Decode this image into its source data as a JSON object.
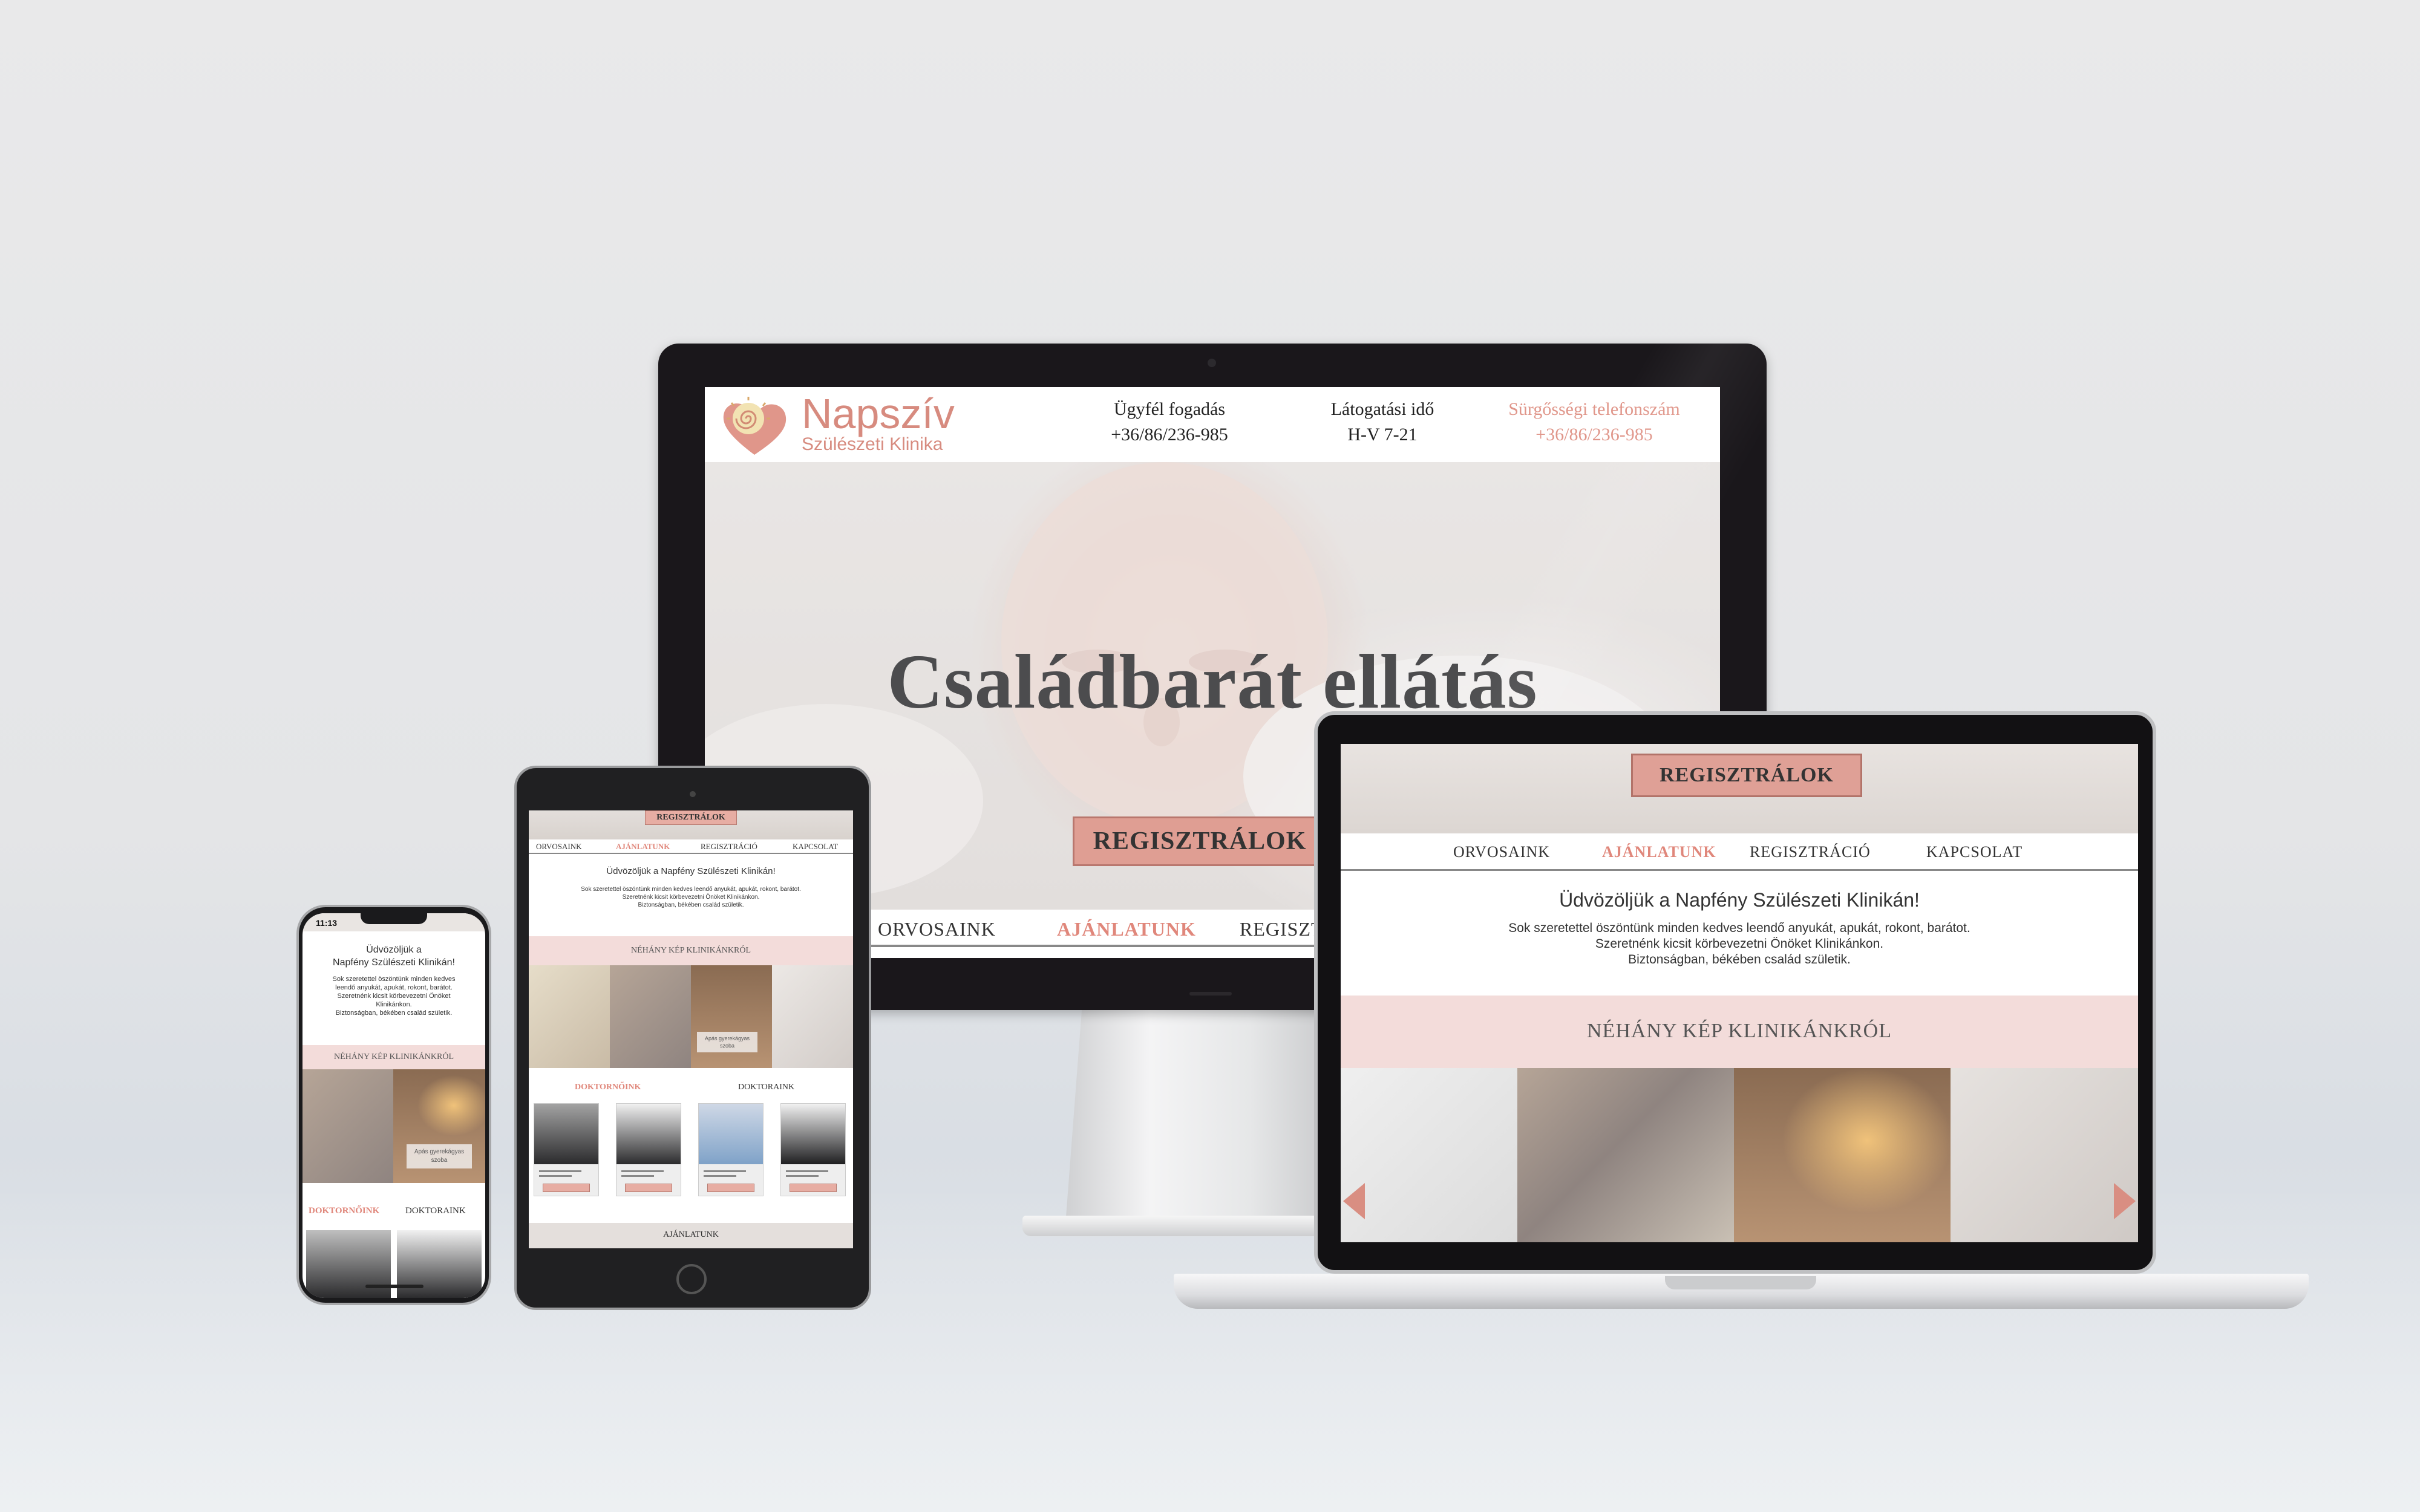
{
  "colors": {
    "accent": "#e0877b",
    "button_fill": "#df9e93",
    "band_pink": "#f3dcda",
    "logo": "#d78b7f",
    "text_dark": "#333333"
  },
  "desktop": {
    "logo": {
      "name": "Napszív",
      "subtitle": "Szülészeti Klinika",
      "icon": "heart-swirl-icon"
    },
    "header_info": [
      {
        "title": "Ügyfél fogadás",
        "value": "+36/86/236-985"
      },
      {
        "title": "Látogatási idő",
        "value": "H-V 7-21"
      },
      {
        "title": "Sürgősségi telefonszám",
        "value": "+36/86/236-985"
      }
    ],
    "hero_title": "Családbarát ellátás",
    "hero_button": "REGISZTRÁLOK",
    "nav": [
      "ORVOSAINK",
      "AJÁNLATUNK",
      "REGISZTR"
    ]
  },
  "laptop": {
    "top_button": "REGISZTRÁLOK",
    "nav": [
      "ORVOSAINK",
      "AJÁNLATUNK",
      "REGISZTRÁCIÓ",
      "KAPCSOLAT"
    ],
    "welcome": "Üdvözöljük a Napfény Szülészeti Klinikán!",
    "text_lines": [
      "Sok szeretettel öszöntünk minden kedves leendő anyukát, apukát, rokont, barátot.",
      "Szeretnénk kicsit körbevezetni Önöket Klinikánkon.",
      "Biztonságban, békében család születik."
    ],
    "band_title": "NÉHÁNY KÉP KLINIKÁNKRÓL"
  },
  "tablet": {
    "top_button": "REGISZTRÁLOK",
    "nav": [
      "ORVOSAINK",
      "AJÁNLATUNK",
      "REGISZTRÁCIÓ",
      "KAPCSOLAT"
    ],
    "welcome": "Üdvözöljük a Napfény Szülészeti Klinikán!",
    "text_lines": [
      "Sok szeretettel öszöntünk minden kedves leendő anyukát, apukát, rokont, barátot.",
      "Szeretnénk kicsit körbevezetni Önöket Klinikánkon.",
      "Biztonságban, békében család születik."
    ],
    "band_title": "NÉHÁNY KÉP KLINIKÁNKRÓL",
    "gallery_caption": "Apás gyerekágyas szoba",
    "tabs": [
      "DOKTORNŐINK",
      "DOKTORAINK"
    ],
    "footer": "AJÁNLATUNK"
  },
  "phone": {
    "time": "11:13",
    "welcome_line1": "Üdvözöljük a",
    "welcome_line2": "Napfény Szülészeti Klinikán!",
    "text_lines": [
      "Sok szeretettel öszöntünk minden kedves",
      "leendő anyukát, apukát, rokont, barátot.",
      "Szeretnénk kicsit körbevezetni Önöket",
      "Klinikánkon.",
      "Biztonságban, békében család születik."
    ],
    "band_title": "NÉHÁNY KÉP KLINIKÁNKRÓL",
    "gallery_caption": "Apás gyerekágyas szoba",
    "tabs": [
      "DOKTORNŐINK",
      "DOKTORAINK"
    ]
  }
}
